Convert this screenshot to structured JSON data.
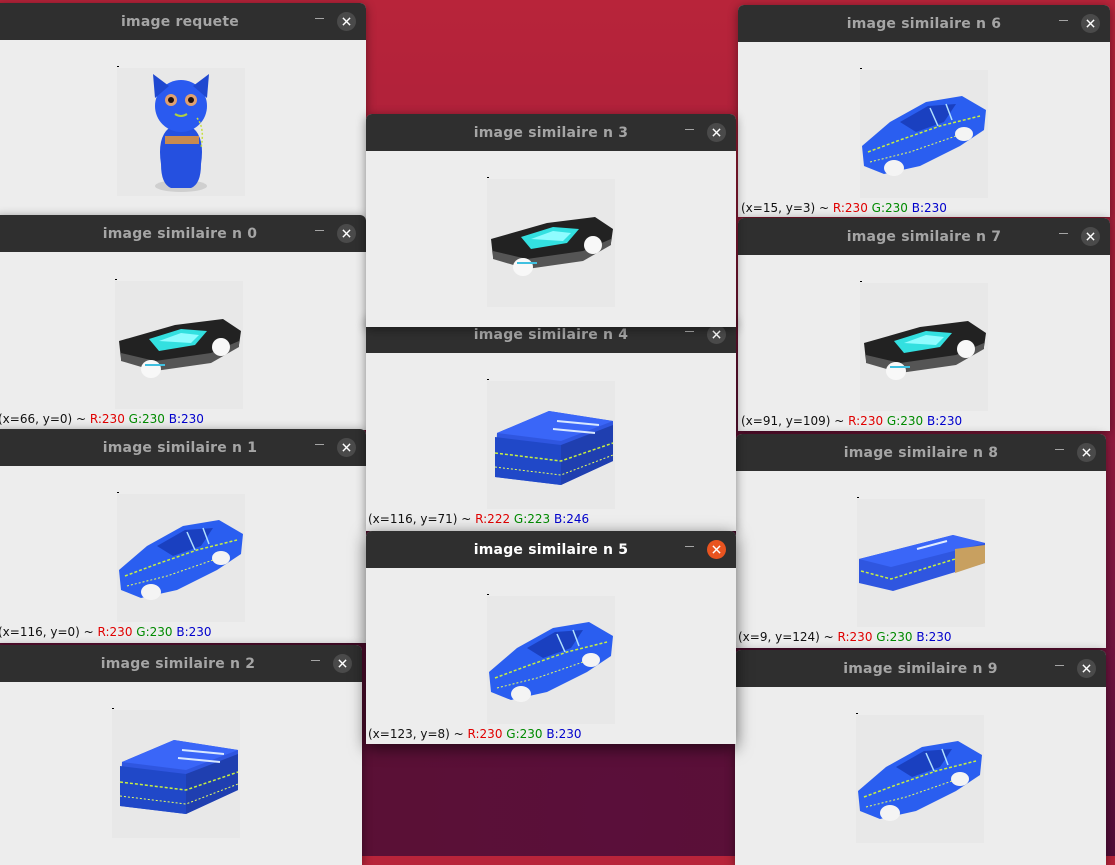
{
  "windows": {
    "requete": {
      "title": "image requete",
      "subject": "cat-figurine"
    },
    "n0": {
      "title": "image similaire n 0",
      "subject": "black-car",
      "status": {
        "coords": "(x=66, y=0) ~ ",
        "r": "R:230",
        "g": "G:230",
        "b": "B:230"
      }
    },
    "n1": {
      "title": "image similaire n 1",
      "subject": "blue-car",
      "status": {
        "coords": "(x=116, y=0) ~ ",
        "r": "R:230",
        "g": "G:230",
        "b": "B:230"
      }
    },
    "n2": {
      "title": "image similaire n 2",
      "subject": "blue-box"
    },
    "n3": {
      "title": "image similaire n 3",
      "subject": "black-car"
    },
    "n4": {
      "title": "image similaire n 4",
      "subject": "blue-box",
      "status": {
        "coords": "(x=116, y=71) ~ ",
        "r": "R:222",
        "g": "G:223",
        "b": "B:246"
      }
    },
    "n5": {
      "title": "image similaire n 5",
      "subject": "blue-car",
      "status": {
        "coords": "(x=123, y=8) ~ ",
        "r": "R:230",
        "g": "G:230",
        "b": "B:230"
      }
    },
    "n6": {
      "title": "image similaire n 6",
      "subject": "blue-car",
      "status": {
        "coords": "(x=15, y=3) ~ ",
        "r": "R:230",
        "g": "G:230",
        "b": "B:230"
      }
    },
    "n7": {
      "title": "image similaire n 7",
      "subject": "black-car",
      "status": {
        "coords": "(x=91, y=109) ~ ",
        "r": "R:230",
        "g": "G:230",
        "b": "B:230"
      }
    },
    "n8": {
      "title": "image similaire n 8",
      "subject": "flat-box",
      "status": {
        "coords": "(x=9, y=124) ~ ",
        "r": "R:230",
        "g": "G:230",
        "b": "B:230"
      }
    },
    "n9": {
      "title": "image similaire n 9",
      "subject": "blue-car"
    }
  },
  "icons": {
    "minimize": "minimize-icon",
    "close": "close-icon"
  },
  "colors": {
    "titlebar": "#2f2f2f",
    "focused_close": "#e95420",
    "window_bg": "#ededed"
  }
}
